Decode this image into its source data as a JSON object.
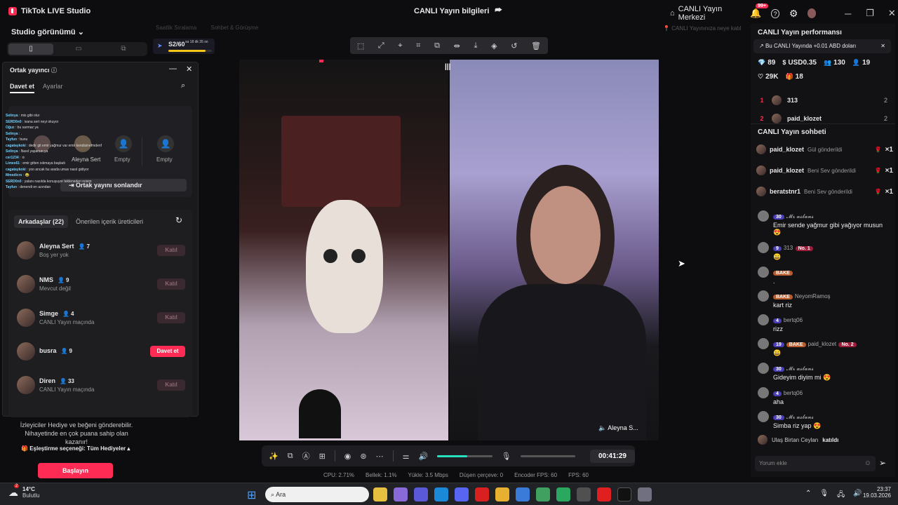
{
  "app": {
    "name": "TikTok LIVE Studio",
    "center_title": "CANLI Yayın bilgileri",
    "center_link": "CANLI Yayın Merkezi",
    "notif_badge": "99+"
  },
  "left": {
    "studio_view": "Studio görünümü",
    "bg_items": [
      "Saatlik Sıralama",
      "Sohbet & Görüşme"
    ],
    "progress_text": "S2/60",
    "progress_time": "sa 18 dk 35 sn",
    "progress_value": 0.85,
    "cohost": {
      "title": "Ortak yayıncı",
      "tabs": [
        "Davet et",
        "Ayarlar"
      ],
      "slots": [
        "Aleyna Sert",
        "Empty",
        "Empty"
      ],
      "end_button": "Ortak yayını sonlandır",
      "friends_tab": "Arkadaşlar (22)",
      "suggested_tab": "Önerilen içerik üreticileri",
      "friends": [
        {
          "name": "Aleyna Sert",
          "count": "7",
          "sub": "Boş yer yok",
          "btn": "Katıl",
          "active": false
        },
        {
          "name": "NMS",
          "count": "9",
          "sub": "Mevcut değil",
          "btn": "Katıl",
          "active": false
        },
        {
          "name": "Simge",
          "count": "4",
          "sub": "CANLI Yayın maçında",
          "btn": "Katıl",
          "active": false
        },
        {
          "name": "busra",
          "count": "9",
          "sub": "",
          "btn": "Davet et",
          "active": true
        },
        {
          "name": "Diren",
          "count": "33",
          "sub": "CANLI Yayın maçında",
          "btn": "Katıl",
          "active": false
        }
      ],
      "chat_lines": [
        [
          "Selinya",
          "mis gibi olur"
        ],
        [
          "SERD0n0",
          "ivana sert neyi okuyor"
        ],
        [
          "Oğuz",
          "bu sarmaz ya"
        ],
        [
          "Selinya",
          "."
        ],
        [
          "Tayfun",
          "bunu"
        ],
        [
          "cagataykoki",
          "dedir git emir yağmur var emir kendisinefmdenf"
        ],
        [
          "Selinya",
          "Nasıl yaparsın ya"
        ],
        [
          "cer1234",
          "♔"
        ],
        [
          "Limes61",
          "emir gitten sıkmaya başladı"
        ],
        [
          "cagataykoki",
          "yoo ancak bu arada umav nasıl gidiyor"
        ],
        [
          "Mmedicrs",
          "😂"
        ],
        [
          "SERD0n0",
          "yalanı nasılda konuşuyor tekleneden reisim"
        ],
        [
          "Tayfun",
          "denendi en azından"
        ]
      ]
    },
    "gift_text": "İzleyiciler Hediye ve beğeni gönderebilir. Nihayetinde en çok puana sahip olan kazanır!",
    "match_option": "Eşleştirme seçeneği: Tüm Hediyeler",
    "start_button": "Başlayın"
  },
  "center": {
    "top_hint": "CANLI Yayınınıza neye katıl",
    "video_label": "Aleyna S...",
    "timer": "00:41:29",
    "volume": 0.55,
    "stats": [
      "CPU: 2.71%",
      "Bellek: 1.1%",
      "Yükle: 3.5 Mbps",
      "Düşen çerçeve: 0",
      "Encoder FPS: 60",
      "FPS: 60"
    ]
  },
  "right": {
    "perf_title": "CANLI Yayın performansı",
    "perf_banner": "Bu CANLI Yayında +0.01 ABD doları",
    "stats_row1": [
      [
        "💎",
        "89"
      ],
      [
        "$",
        "USD0.35"
      ],
      [
        "👥",
        "130"
      ],
      [
        "👤",
        "19"
      ]
    ],
    "stats_row2": [
      [
        "♡",
        "29K"
      ],
      [
        "🎁",
        "18"
      ]
    ],
    "ranking": [
      {
        "rank": "1",
        "name": "313",
        "score": "2"
      },
      {
        "rank": "2",
        "name": "paid_klozet",
        "score": "2"
      }
    ],
    "chat_title": "CANLI Yayın sohbeti",
    "gifts": [
      {
        "name": "paid_klozet",
        "action": "Gül gönderildi",
        "count": "×1"
      },
      {
        "name": "paid_klozet",
        "action": "Beni Sev gönderildi",
        "count": "×1"
      },
      {
        "name": "beratstnr1",
        "action": "Beni Sev gönderildi",
        "count": "×1"
      }
    ],
    "messages": [
      {
        "level": "30",
        "badge": "",
        "no": "",
        "user": "𝓜𝓻 𝓪𝓼𝓵𝓪𝓷𝓼",
        "text": "Emir sende yağmur gibi yağıyor musun 😍"
      },
      {
        "level": "9",
        "badge": "",
        "no": "No. 1",
        "user": "313",
        "text": "😄"
      },
      {
        "level": "",
        "badge": "BAKE",
        "no": "",
        "user": "",
        "text": "."
      },
      {
        "level": "",
        "badge": "BAKE",
        "no": "",
        "user": "NeyomRamoş",
        "text": "kart riz"
      },
      {
        "level": "4",
        "badge": "",
        "no": "",
        "user": "bertq06",
        "text": "rizz"
      },
      {
        "level": "19",
        "badge": "BAKE",
        "no": "No. 2",
        "user": "paid_klozet",
        "text": "😄"
      },
      {
        "level": "30",
        "badge": "",
        "no": "",
        "user": "𝓜𝓻 𝓪𝓼𝓵𝓪𝓷𝓼",
        "text": "Gideyim diyim mi 😍"
      },
      {
        "level": "4",
        "badge": "",
        "no": "",
        "user": "bertq06",
        "text": "aha"
      },
      {
        "level": "30",
        "badge": "",
        "no": "",
        "user": "𝓜𝓻 𝓪𝓼𝓵𝓪𝓷𝓼",
        "text": "Simba riz yap 😍"
      }
    ],
    "join_line": {
      "user": "Ulaş Birtan Ceylan",
      "action": "katıldı"
    },
    "comment_placeholder": "Yorum ekle"
  },
  "taskbar": {
    "weather_temp": "14°C",
    "weather_desc": "Bulutlu",
    "weather_badge": "2",
    "search_placeholder": "Ara",
    "time": "23:37",
    "date": "19.03.2026"
  }
}
